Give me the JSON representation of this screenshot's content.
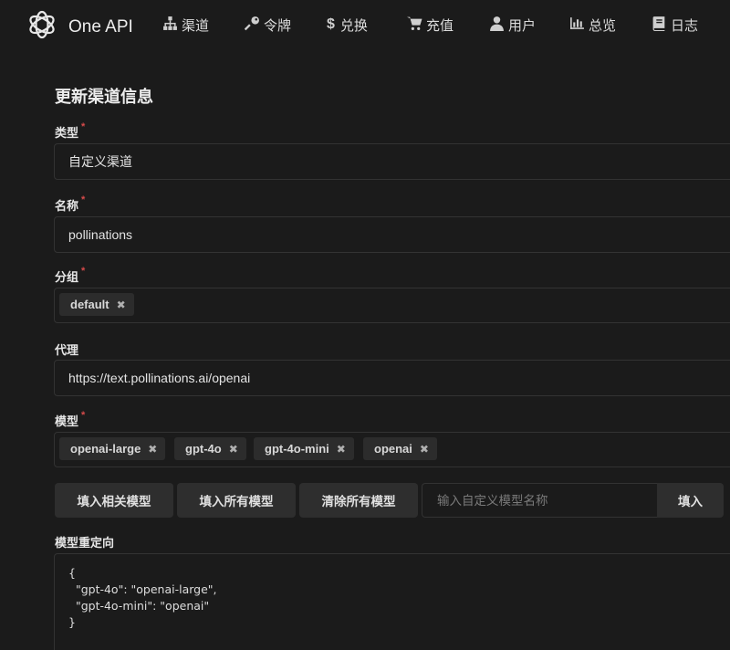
{
  "app": {
    "name": "One API",
    "logo_icon": "openai-logo-icon"
  },
  "nav": [
    {
      "id": "channels",
      "label": "渠道",
      "icon": "sitemap-icon"
    },
    {
      "id": "tokens",
      "label": "令牌",
      "icon": "key-icon"
    },
    {
      "id": "redeem",
      "label": "兑换",
      "icon": "dollar-icon"
    },
    {
      "id": "topup",
      "label": "充值",
      "icon": "cart-icon"
    },
    {
      "id": "users",
      "label": "用户",
      "icon": "user-icon"
    },
    {
      "id": "overview",
      "label": "总览",
      "icon": "bar-chart-icon"
    },
    {
      "id": "logs",
      "label": "日志",
      "icon": "book-icon"
    }
  ],
  "form": {
    "title": "更新渠道信息",
    "type": {
      "label": "类型",
      "required_mark": "*",
      "value": "自定义渠道"
    },
    "name": {
      "label": "名称",
      "required_mark": "*",
      "value": "pollinations"
    },
    "group": {
      "label": "分组",
      "required_mark": "*",
      "chips": [
        "default"
      ],
      "remove_glyph": "✖"
    },
    "proxy": {
      "label": "代理",
      "value": "https://text.pollinations.ai/openai"
    },
    "models": {
      "label": "模型",
      "required_mark": "*",
      "chips": [
        "openai-large",
        "gpt-4o",
        "gpt-4o-mini",
        "openai"
      ],
      "remove_glyph": "✖"
    },
    "buttons": {
      "fill_related": "填入相关模型",
      "fill_all": "填入所有模型",
      "clear_all": "清除所有模型",
      "custom_placeholder": "输入自定义模型名称",
      "custom_value": "",
      "fill": "填入"
    },
    "model_mapping": {
      "label": "模型重定向",
      "value": "{\n  \"gpt-4o\": \"openai-large\",\n  \"gpt-4o-mini\": \"openai\"\n}"
    }
  },
  "colors": {
    "background": "#1b1b1b",
    "border": "#333333",
    "chip_bg": "#2c2c2c",
    "button_bg": "#2e2e2e",
    "required": "#d74b4b"
  }
}
